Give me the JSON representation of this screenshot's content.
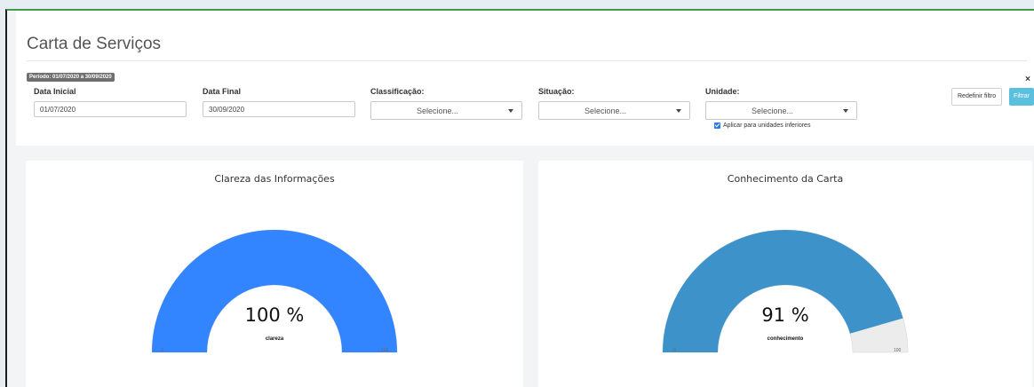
{
  "page": {
    "title": "Carta de Serviços"
  },
  "filters": {
    "period_badge": "Período: 01/07/2020 a 30/09/2020",
    "data_inicial": {
      "label": "Data Inicial",
      "value": "01/07/2020"
    },
    "data_final": {
      "label": "Data Final",
      "value": "30/09/2020"
    },
    "classificacao": {
      "label": "Classificação:",
      "selected": "Selecione..."
    },
    "situacao": {
      "label": "Situação:",
      "selected": "Selecione..."
    },
    "unidade": {
      "label": "Unidade:",
      "selected": "Selecione..."
    },
    "aplicar_checkbox": {
      "label": "Aplicar para unidades inferiores",
      "checked": true
    },
    "close_symbol": "×"
  },
  "buttons": {
    "reset": "Redefinir filtro",
    "filter": "Filtrar"
  },
  "colors": {
    "filter_button": "#5bc0de",
    "gauge_clareza": "#3385ff",
    "gauge_conhecimento": "#3d93c9",
    "gauge_track": "#ececec"
  },
  "chart_data": [
    {
      "type": "gauge",
      "title": "Clareza das Informações",
      "value": 100,
      "display": "100 %",
      "label": "clareza",
      "min": 0,
      "max": 100,
      "min_label": "0",
      "max_label": "100",
      "color": "#3385ff"
    },
    {
      "type": "gauge",
      "title": "Conhecimento da Carta",
      "value": 91,
      "display": "91 %",
      "label": "conhecimento",
      "min": 0,
      "max": 100,
      "min_label": "0",
      "max_label": "100",
      "color": "#3d93c9"
    }
  ]
}
